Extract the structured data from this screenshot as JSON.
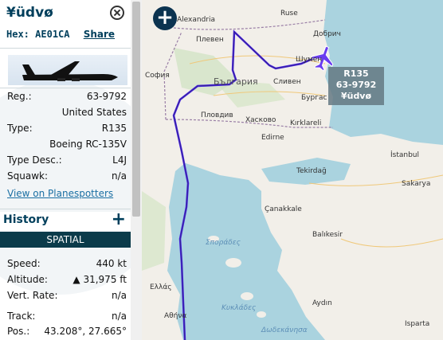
{
  "aircraft": {
    "title": "¥üdvø",
    "hex_label": "Hex:",
    "hex": "AE01CA",
    "share": "Share",
    "fields": [
      {
        "k": "Reg.:",
        "v": "63-9792"
      },
      {
        "k": "",
        "v": "United States"
      },
      {
        "k": "Type:",
        "v": "R135"
      },
      {
        "k": "",
        "v": "Boeing RC-135V"
      },
      {
        "k": "Type Desc.:",
        "v": "L4J"
      },
      {
        "k": "Squawk:",
        "v": "n/a"
      }
    ],
    "photo_link": "View on Planespotters"
  },
  "history": {
    "title": "History",
    "plus": "+"
  },
  "spatial": {
    "title": "SPATIAL",
    "fields": [
      {
        "k": "Speed:",
        "v": "440 kt"
      },
      {
        "k": "Altitude:",
        "v": "▲ 31,975 ft"
      },
      {
        "k": "Vert. Rate:",
        "v": "n/a"
      },
      {
        "k": "Track:",
        "v": "n/a"
      },
      {
        "k": "Pos.:",
        "v": "43.208°, 27.665°"
      }
    ]
  },
  "map": {
    "zoom_plus": "+",
    "callout": [
      "R135",
      "63-9792",
      "¥üdvø"
    ],
    "labels": [
      "Alexandria",
      "Ruse",
      "Добрич",
      "Плевен",
      "Шумен",
      "София",
      "България",
      "Сливен",
      "Бургас",
      "Пловдив",
      "Хасково",
      "Edirne",
      "Kırklareli",
      "İstanbul",
      "Tekirdağ",
      "Sakarya",
      "Çanakkale",
      "Balıkesir",
      "Ελλάς",
      "Αθήνα",
      "Aydın",
      "Isparta",
      "Κυκλάδες",
      "Σποράδες",
      "Δωδεκάνησα"
    ]
  },
  "colors": {
    "accent": "#003f5c",
    "track": "#4422dd",
    "sea": "#aad3df",
    "land": "#f2efe9"
  }
}
